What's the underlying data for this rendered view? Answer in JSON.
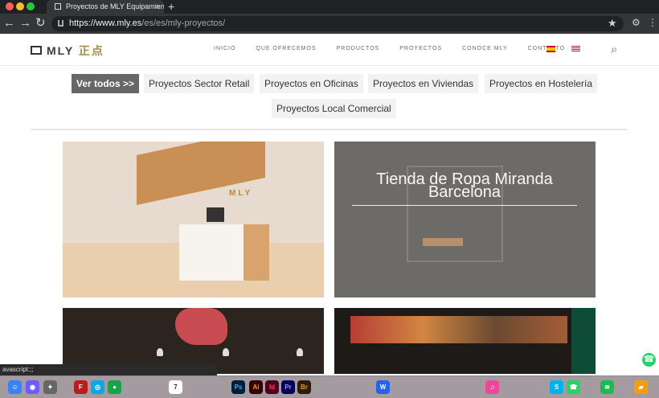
{
  "browser": {
    "tab_title": "Proyectos de MLY Equipamient",
    "tab_close": "×",
    "new_tab": "+",
    "url_prefix": "https://www.mly.es",
    "url_path": "/es/es/mly-proyectos/",
    "status_text": "avascript:;;"
  },
  "site": {
    "logo_text": "MLY",
    "logo_cjk": "正点",
    "menu": [
      "INICIO",
      "QUE OFRECEMOS",
      "PRODUCTOS",
      "PROYECTOS",
      "CONOCE MLY",
      "CONTACTO"
    ]
  },
  "filters": [
    {
      "label": "Ver todos >>",
      "active": true
    },
    {
      "label": "Proyectos Sector Retail"
    },
    {
      "label": "Proyectos en Oficinas"
    },
    {
      "label": "Proyectos en Viviendas"
    },
    {
      "label": "Proyectos en Hostelería"
    },
    {
      "label": "Proyectos Local Comercial"
    }
  ],
  "projects": [
    {
      "brand": "MLY"
    },
    {
      "caption_line_1": "Tienda de Ropa Miranda",
      "caption_line_2": "Barcelona"
    }
  ],
  "icons": {
    "star": "★",
    "search": "⌕",
    "whatsapp": "☎"
  },
  "colors": {
    "chrome_dark": "#202124",
    "active_filter": "#676767",
    "filter_bg": "#f2f2f2",
    "whatsapp_green": "#25d366"
  }
}
